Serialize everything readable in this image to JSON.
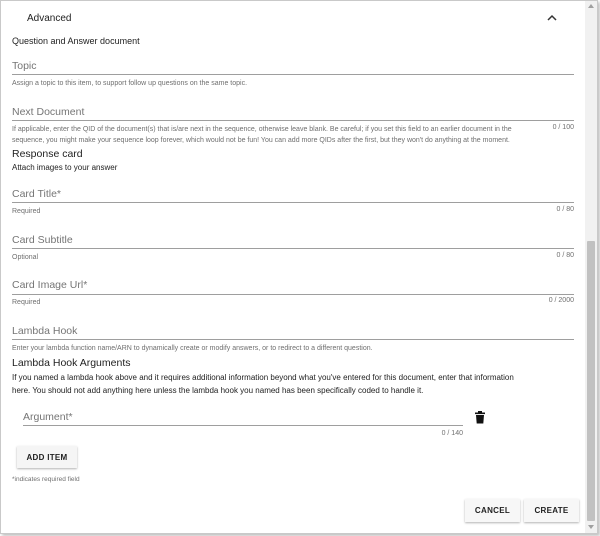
{
  "header": {
    "title": "Advanced"
  },
  "form": {
    "section_title": "Question and Answer document",
    "topic": {
      "label": "Topic",
      "hint": "Assign a topic to this item, to support follow up questions on the same topic."
    },
    "next_document": {
      "label": "Next Document",
      "hint_line1": "If applicable, enter the QID of the document(s) that is/are next in the sequence, otherwise leave blank. Be careful; if you set this field to an earlier document in the",
      "hint_line2": "sequence, you might make your sequence loop forever, which would not be fun! You can add more QIDs after the first, but they won't do anything at the moment.",
      "counter": "0 / 100"
    },
    "response_card": {
      "heading": "Response card",
      "subtext": "Attach images to your answer"
    },
    "card_title": {
      "label": "Card Title*",
      "hint": "Required",
      "counter": "0 / 80"
    },
    "card_subtitle": {
      "label": "Card Subtitle",
      "hint": "Optional",
      "counter": "0 / 80"
    },
    "card_image_url": {
      "label": "Card Image Url*",
      "hint": "Required",
      "counter": "0 / 2000"
    },
    "lambda_hook": {
      "label": "Lambda Hook",
      "hint": "Enter your lambda function name/ARN to dynamically create or modify answers, or to redirect to a different question."
    },
    "lambda_args": {
      "heading": "Lambda Hook Arguments",
      "desc_line1": "If you named a lambda hook above and it requires additional information beyond what you've entered for this document, enter that information",
      "desc_line2": "here. You should not add anything here unless the lambda hook you named has been specifically coded to handle it."
    },
    "argument": {
      "label": "Argument*",
      "counter": "0 / 140"
    },
    "add_item_label": "ADD ITEM",
    "required_note": "*indicates required field"
  },
  "actions": {
    "cancel_label": "CANCEL",
    "create_label": "CREATE"
  },
  "icons": {
    "collapse": "chevron-up-icon",
    "delete": "trash-icon"
  }
}
